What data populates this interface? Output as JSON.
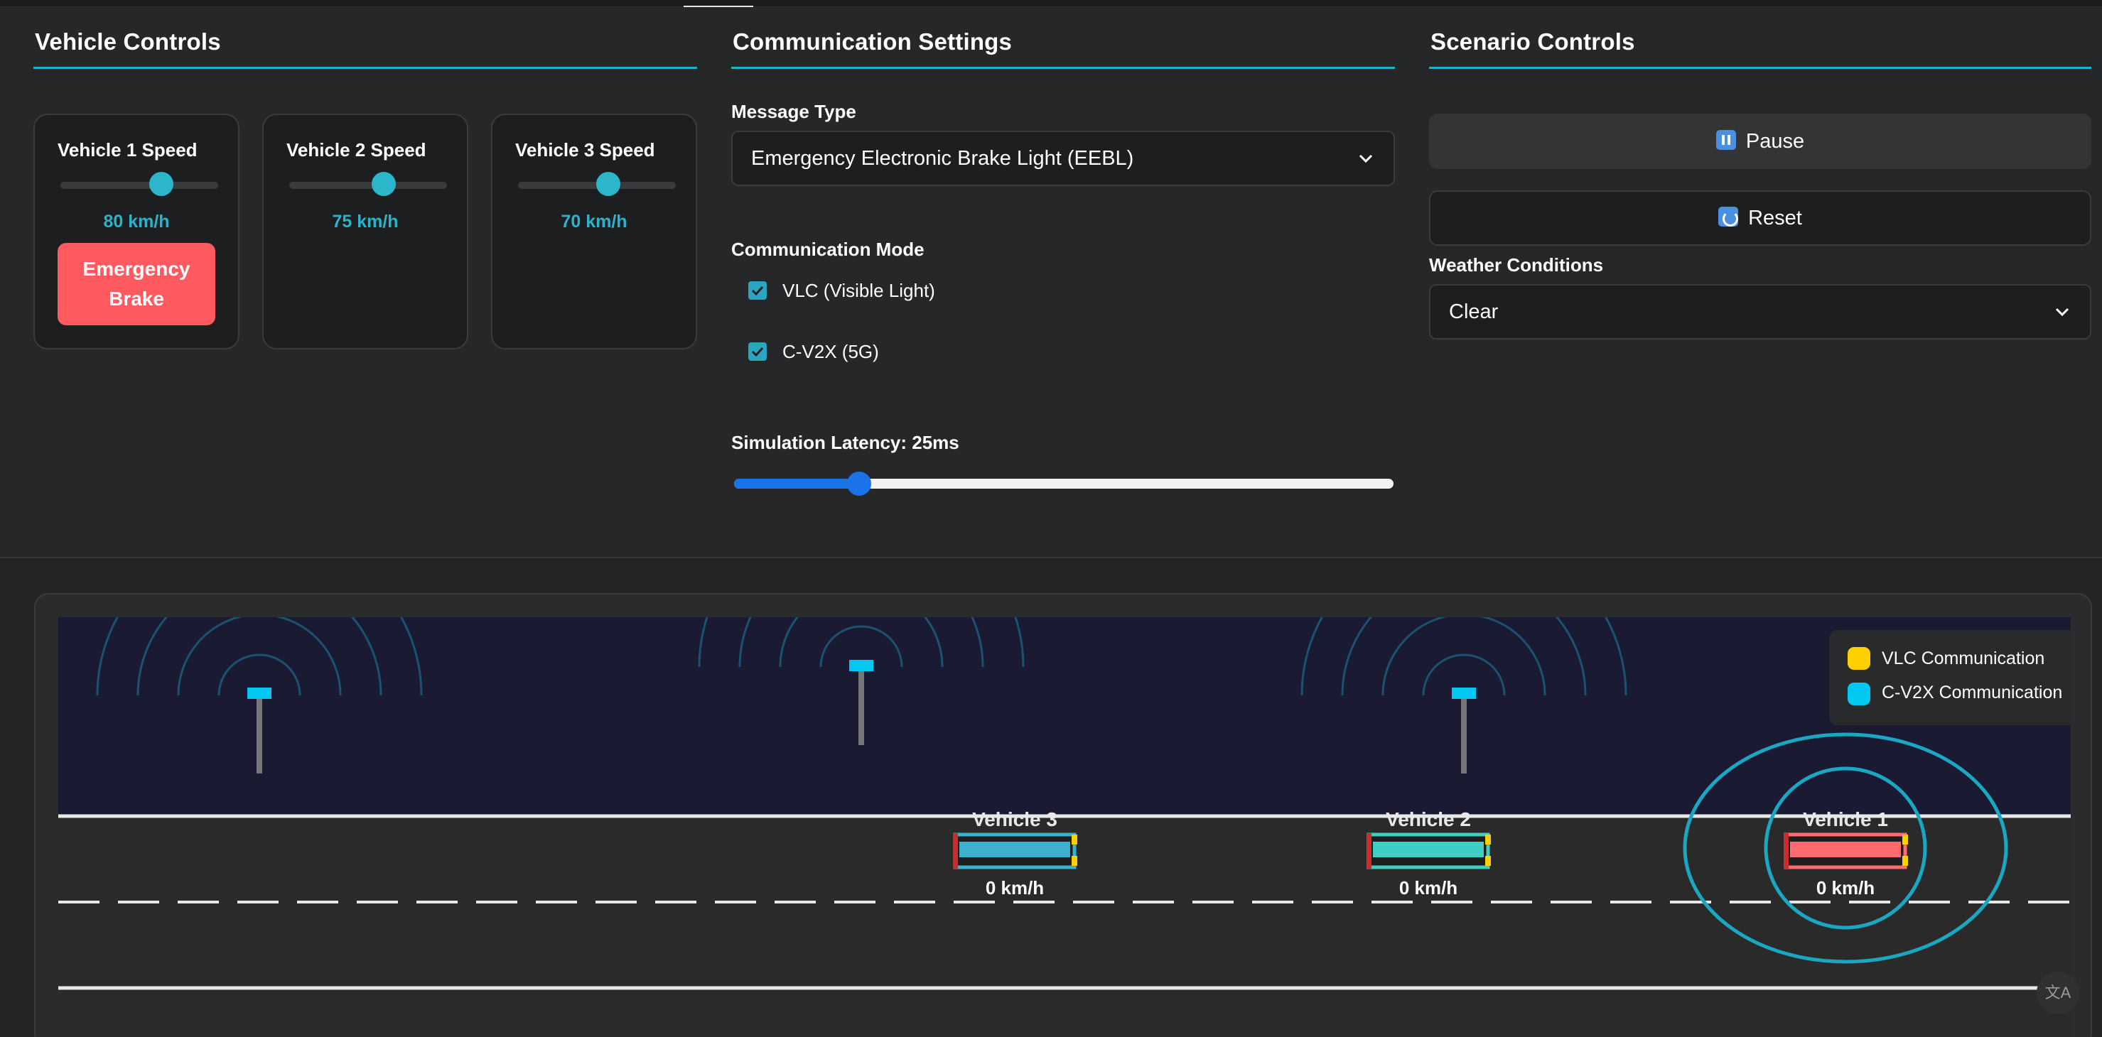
{
  "vehicle_controls": {
    "title": "Vehicle Controls",
    "vehicles": [
      {
        "label": "Vehicle 1 Speed",
        "speed": "80 km/h",
        "slider_fraction": 0.64
      },
      {
        "label": "Vehicle 2 Speed",
        "speed": "75 km/h",
        "slider_fraction": 0.6
      },
      {
        "label": "Vehicle 3 Speed",
        "speed": "70 km/h",
        "slider_fraction": 0.57
      }
    ],
    "emergency_brake_label": "Emergency Brake"
  },
  "communication_settings": {
    "title": "Communication Settings",
    "message_type_label": "Message Type",
    "message_type_value": "Emergency Electronic Brake Light (EEBL)",
    "mode_label": "Communication Mode",
    "modes": [
      {
        "label": "VLC (Visible Light)",
        "checked": true
      },
      {
        "label": "C-V2X (5G)",
        "checked": true
      }
    ],
    "latency_label": "Simulation Latency: 25ms",
    "latency_fraction": 0.19
  },
  "scenario_controls": {
    "title": "Scenario Controls",
    "pause_label": "Pause",
    "reset_label": "Reset",
    "weather_label": "Weather Conditions",
    "weather_value": "Clear"
  },
  "simulation": {
    "legend": [
      {
        "label": "VLC Communication",
        "color": "#ffd000"
      },
      {
        "label": "C-V2X Communication",
        "color": "#00c8f0"
      }
    ],
    "vehicles": [
      {
        "name": "Vehicle 3",
        "speed": "0 km/h",
        "color": "#3eb0cf"
      },
      {
        "name": "Vehicle 2",
        "speed": "0 km/h",
        "color": "#3ecfc2"
      },
      {
        "name": "Vehicle 1",
        "speed": "0 km/h",
        "color": "#ff6b6f"
      }
    ]
  },
  "colors": {
    "accent": "#1fb3cf",
    "brake": "#ff5a5f",
    "latency_slider": "#1a73e8"
  },
  "translate_icon": "translate-icon"
}
